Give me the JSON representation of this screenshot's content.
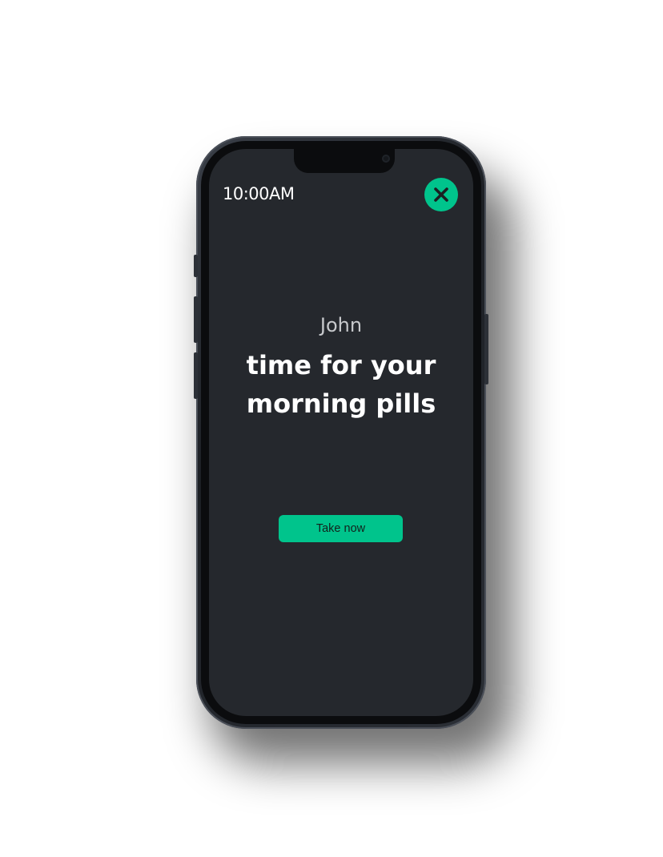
{
  "status": {
    "time": "10:00AM"
  },
  "reminder": {
    "name": "John",
    "message": "time for your morning pills"
  },
  "actions": {
    "take_label": "Take now",
    "close_icon": "close-icon"
  },
  "colors": {
    "accent": "#00c48c",
    "screen_background": "#25282d",
    "text_primary": "#ffffff",
    "text_secondary": "#c7c9cc"
  }
}
